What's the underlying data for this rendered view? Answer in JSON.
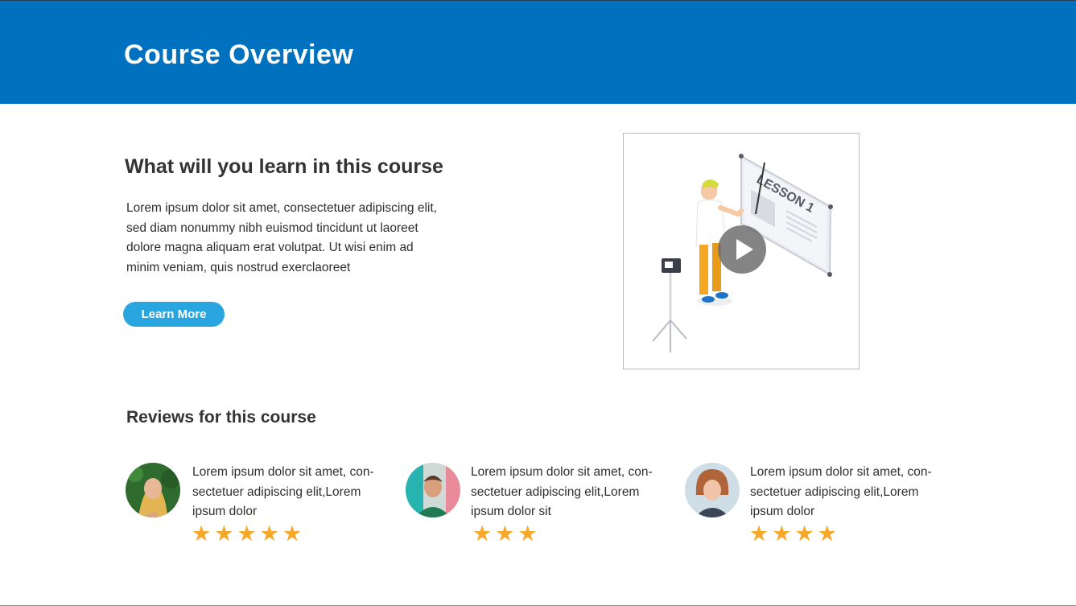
{
  "header": {
    "title": "Course Overview"
  },
  "learn": {
    "heading": "What will you learn in this course",
    "description": "Lorem ipsum dolor sit amet, consectetuer adipiscing elit, sed diam nonummy nibh euismod tincidunt ut laoreet dolore magna aliquam erat volutpat. Ut wisi enim ad minim veniam, quis nostrud exerclaoreet",
    "button_label": "Learn More"
  },
  "video": {
    "board_text": "LESSON 1"
  },
  "reviews": {
    "heading": "Reviews for this course",
    "items": [
      {
        "text": "Lorem ipsum dolor sit amet, con-sectetuer adipiscing elit,Lorem ipsum dolor",
        "rating": 5
      },
      {
        "text": "Lorem ipsum dolor sit amet, con-sectetuer adipiscing elit,Lorem ipsum dolor sit",
        "rating": 3
      },
      {
        "text": "Lorem ipsum dolor sit amet, con-sectetuer adipiscing elit,Lorem ipsum dolor",
        "rating": 4
      }
    ]
  },
  "colors": {
    "header": "#0071bf",
    "button": "#29a6e0",
    "star": "#f7a828"
  },
  "icons": {
    "play": "play-icon",
    "star": "star-icon"
  }
}
